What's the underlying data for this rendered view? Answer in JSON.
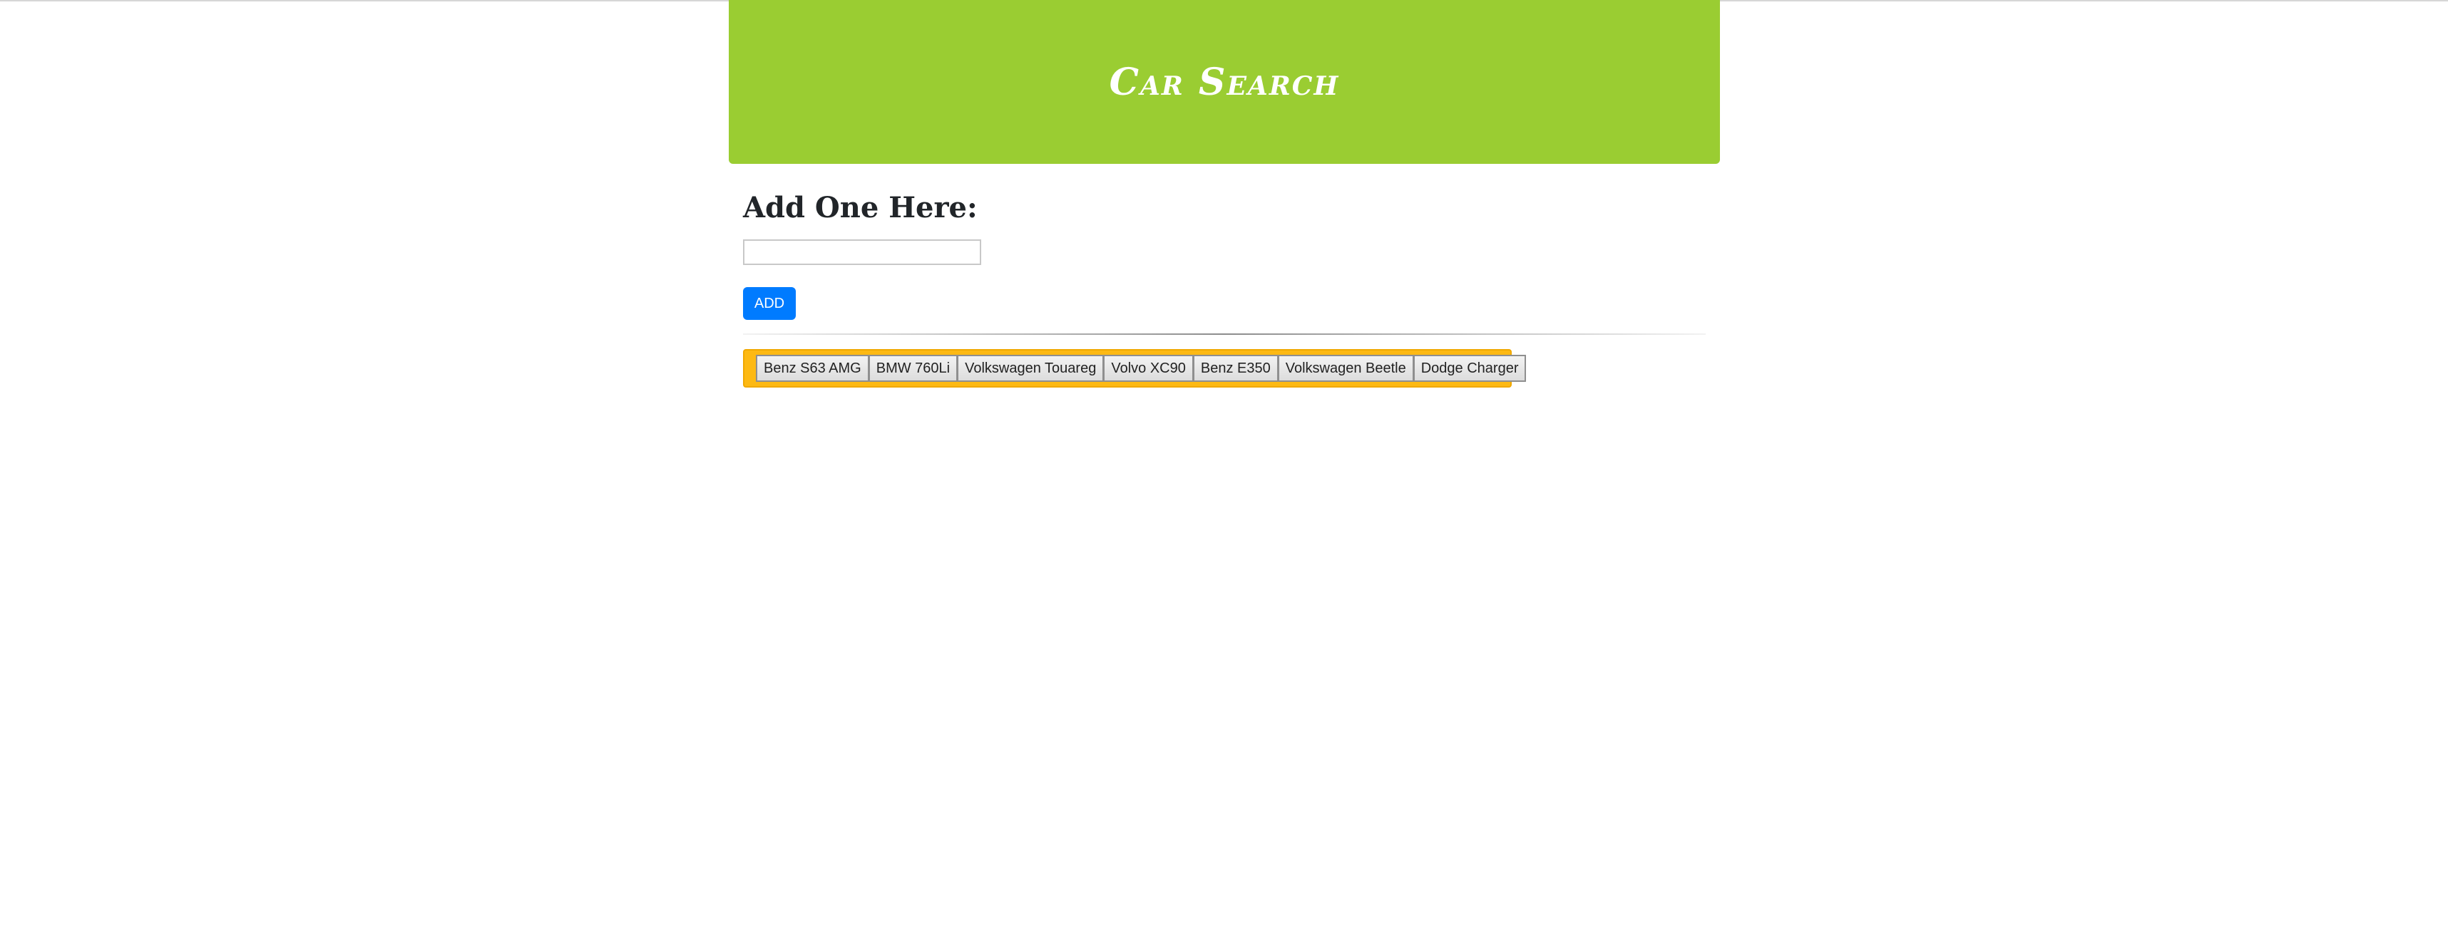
{
  "header": {
    "title": "Car Search"
  },
  "form": {
    "heading": "Add One Here:",
    "input_value": "",
    "add_label": "ADD"
  },
  "cars": [
    "Benz S63 AMG",
    "BMW 760Li",
    "Volkswagen Touareg",
    "Volvo XC90",
    "Benz E350",
    "Volkswagen Beetle",
    "Dodge Charger"
  ],
  "colors": {
    "header_bg": "#9acd32",
    "button_bar_bg": "#fdb913",
    "add_button_bg": "#007bff"
  }
}
